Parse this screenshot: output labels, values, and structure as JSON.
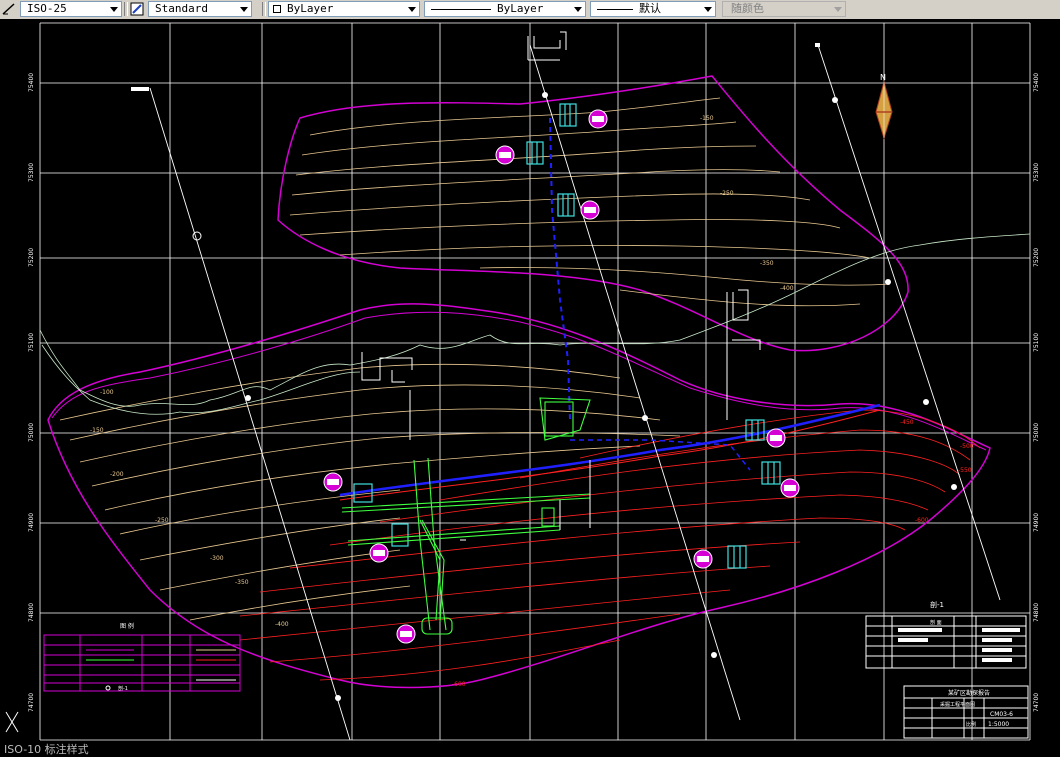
{
  "toolbar": {
    "dimstyle": "ISO-25",
    "textstyle": "Standard",
    "layer": "ByLayer",
    "linetype": "ByLayer",
    "lineweight": "默认",
    "plotstyle": "随颜色"
  },
  "drawing": {
    "grid_left_labels": [
      "75400",
      "75300",
      "75200",
      "75100",
      "75000",
      "74900",
      "74800",
      "74700"
    ],
    "grid_right_labels": [
      "75400",
      "75300",
      "75200",
      "75100",
      "75000",
      "74900",
      "74800",
      "74700"
    ],
    "section_label": "剖-1",
    "compass_label": "N",
    "contour_labels_yellow": [
      "-100",
      "-150",
      "-200",
      "-250",
      "-300",
      "-350",
      "-400"
    ],
    "contour_labels_red": [
      "-450",
      "-500",
      "-550",
      "-600"
    ],
    "legend_title": "图 例",
    "legend_bottom_label": "剖-1",
    "title_block_title": "某矿区勘探报告",
    "title_block_subtitle": "采掘工程平面图",
    "title_block_number": "CM03-6",
    "title_block_scale_label": "比例",
    "title_block_scale": "1:5000",
    "info_table_title": "剖 面"
  },
  "status": {
    "left_text": "ISO-10 标注样式"
  },
  "colors": {
    "magenta": "#d400d4",
    "contour_yellow": "#e8c890",
    "contour_red": "#ff2020",
    "grid": "#ffffff",
    "blue_line": "#2020ff",
    "green": "#40ff40",
    "cyan": "#40e0e0"
  }
}
